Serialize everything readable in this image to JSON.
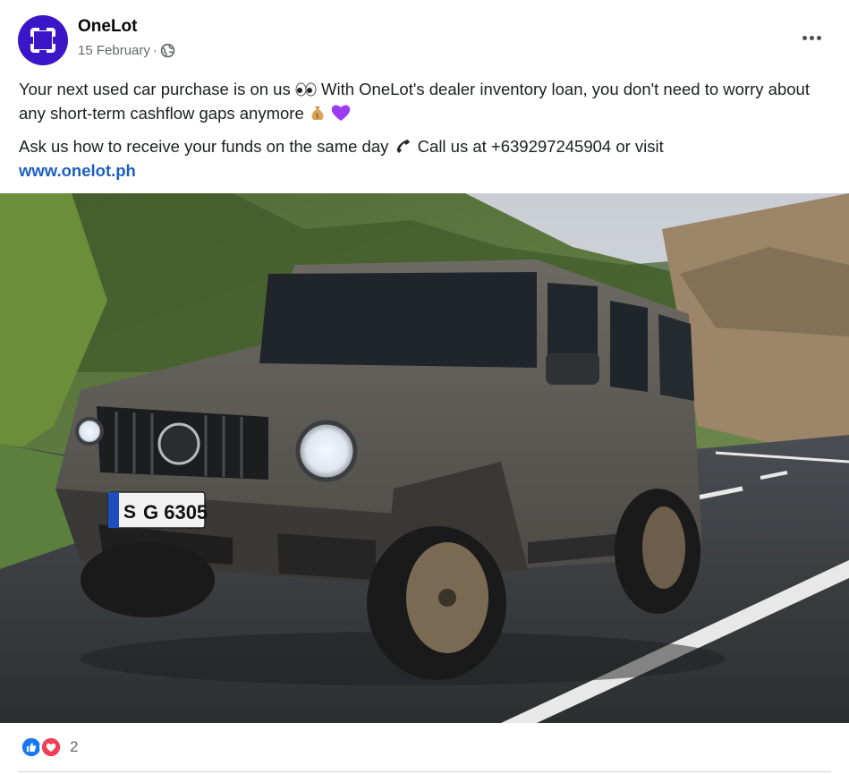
{
  "post": {
    "page_name": "OneLot",
    "date": "15 February",
    "separator": "·",
    "caption_line1": "Your next used car purchase is on us",
    "caption_line1b": " With OneLot's dealer inventory loan, you don't need to worry about any short-term cashflow gaps anymore",
    "caption_line2": "Ask us how to receive your funds on the same day",
    "caption_line2b": " Call us at +639297245904 or visit",
    "link": "www.onelot.ph",
    "photo": {
      "plate_prefix": "S",
      "plate_number": "G 6305"
    }
  },
  "reactions": {
    "count": "2"
  },
  "colors": {
    "brand": "#3b16c9",
    "link": "#1b5fc1",
    "like": "#1877f2",
    "love": "#f33e58"
  },
  "icons": [
    "globe-icon",
    "more-icon",
    "eyes-emoji",
    "money-bag-emoji",
    "purple-heart-emoji",
    "telephone-emoji",
    "like-reaction-icon",
    "love-reaction-icon"
  ]
}
